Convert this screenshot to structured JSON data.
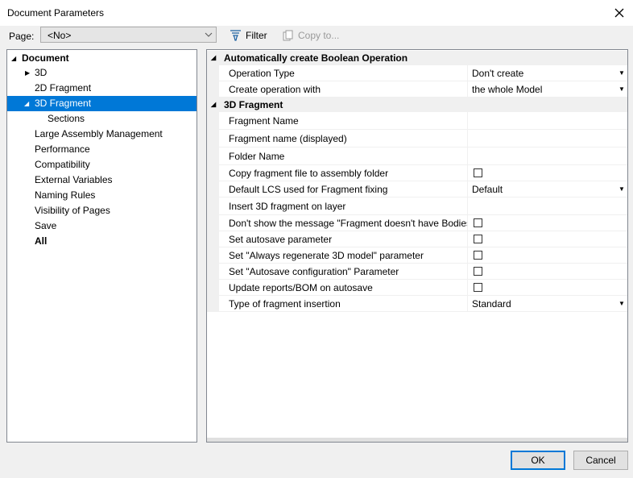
{
  "window": {
    "title": "Document Parameters"
  },
  "toolbar": {
    "page_label": "Page:",
    "page_value": "<No>",
    "filter_label": "Filter",
    "copy_label": "Copy to..."
  },
  "tree": {
    "items": [
      {
        "label": "Document"
      },
      {
        "label": "3D"
      },
      {
        "label": "2D Fragment"
      },
      {
        "label": "3D Fragment"
      },
      {
        "label": "Sections"
      },
      {
        "label": "Large Assembly Management"
      },
      {
        "label": "Performance"
      },
      {
        "label": "Compatibility"
      },
      {
        "label": "External Variables"
      },
      {
        "label": "Naming Rules"
      },
      {
        "label": "Visibility of Pages"
      },
      {
        "label": "Save"
      },
      {
        "label": "All"
      }
    ]
  },
  "grid": {
    "categories": [
      {
        "label": "Automatically create Boolean Operation"
      },
      {
        "label": "3D Fragment"
      }
    ],
    "props": [
      {
        "name": "Operation Type",
        "value": "Don't create"
      },
      {
        "name": "Create operation with",
        "value": "the whole Model"
      },
      {
        "name": "Fragment Name",
        "value": ""
      },
      {
        "name": "Fragment name (displayed)",
        "value": ""
      },
      {
        "name": "Folder Name",
        "value": ""
      },
      {
        "name": "Copy fragment file to assembly folder",
        "value": "",
        "checked": false
      },
      {
        "name": "Default LCS used for Fragment fixing",
        "value": "Default"
      },
      {
        "name": "Insert 3D fragment on layer",
        "value": ""
      },
      {
        "name": "Don't show the message \"Fragment doesn't have Bodies\"",
        "value": "",
        "checked": false
      },
      {
        "name": "Set autosave parameter",
        "value": "",
        "checked": false
      },
      {
        "name": "Set \"Always regenerate 3D model\" parameter",
        "value": "",
        "checked": false
      },
      {
        "name": "Set \"Autosave configuration\" Parameter",
        "value": "",
        "checked": false
      },
      {
        "name": "Update reports/BOM on autosave",
        "value": "",
        "checked": false
      },
      {
        "name": "Type of fragment insertion",
        "value": "Standard"
      }
    ]
  },
  "buttons": {
    "ok": "OK",
    "cancel": "Cancel"
  }
}
